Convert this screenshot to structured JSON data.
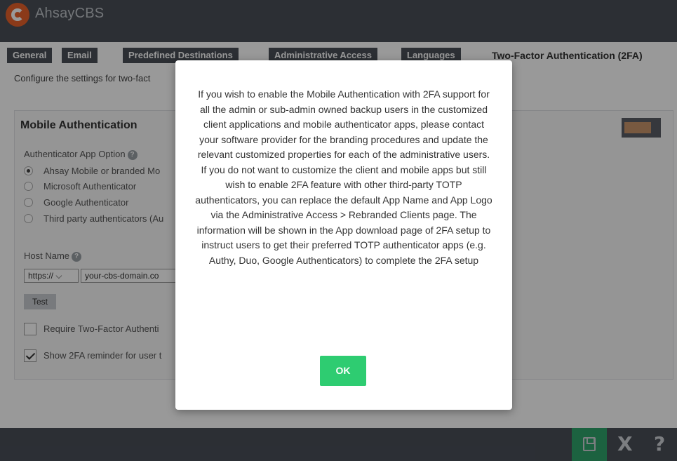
{
  "app": {
    "title": "AhsayCBS"
  },
  "tabs": [
    {
      "label": "General"
    },
    {
      "label": "Email"
    },
    {
      "label": "Predefined Destinations"
    },
    {
      "label": "Administrative Access"
    },
    {
      "label": "Languages"
    },
    {
      "label": "Two-Factor Authentication (2FA)"
    }
  ],
  "page": {
    "subtitle": "Configure the settings for two-fact"
  },
  "mobile_auth": {
    "title": "Mobile Authentication",
    "toggle_state": "on",
    "app_option_label": "Authenticator App Option",
    "options": [
      {
        "label": "Ahsay Mobile or branded Mo",
        "selected": true
      },
      {
        "label": "Microsoft Authenticator",
        "selected": false
      },
      {
        "label": "Google Authenticator",
        "selected": false
      },
      {
        "label": "Third party authenticators (Au",
        "selected": false
      }
    ],
    "host_name_label": "Host Name",
    "protocol_value": "https://",
    "host_value": "your-cbs-domain.co",
    "test_label": "Test",
    "require_2fa_label": "Require Two-Factor Authenti",
    "require_2fa_checked": false,
    "reminder_label": "Show 2FA reminder for user t",
    "reminder_checked": true
  },
  "help_icon_glyph": "?",
  "footer": {
    "close_glyph": "X",
    "help_glyph": "?"
  },
  "modal": {
    "message": "If you wish to enable the Mobile Authentication with 2FA support for all the admin or sub-admin owned backup users in the customized client applications and mobile authenticator apps, please contact your software provider for the branding procedures and update the relevant customized properties for each of the administrative users. If you do not want to customize the client and mobile apps but still wish to enable 2FA feature with other third-party TOTP authenticators, you can replace the default App Name and App Logo via the Administrative Access > Rebranded Clients page. The information will be shown in the App download page of 2FA setup to instruct users to get their preferred TOTP authenticator apps (e.g. Authy, Duo, Google Authenticators) to complete the 2FA setup",
    "ok_label": "OK"
  },
  "colors": {
    "header_bg": "#4a4f58",
    "logo_orange": "#e8622a",
    "ok_green": "#2ecc71",
    "save_green": "#2fa36b",
    "toggle_fill": "#c8956b"
  }
}
